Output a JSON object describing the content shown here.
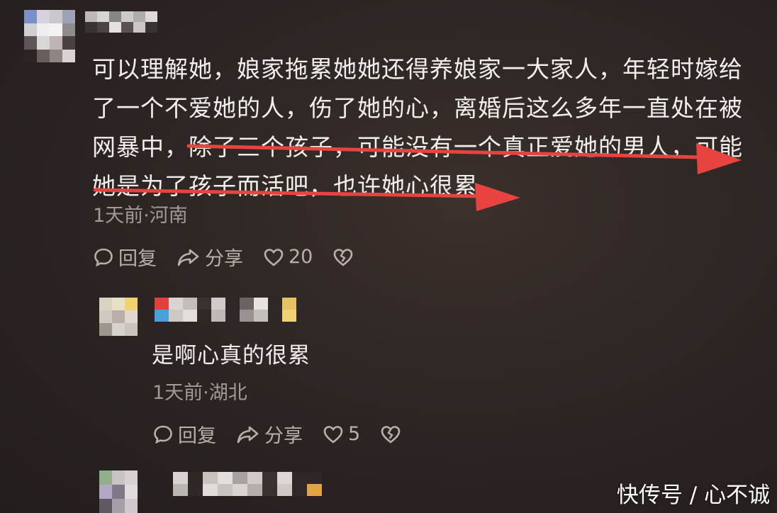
{
  "comment": {
    "lines": [
      "可以理解她，娘家拖累她她还得养娘家一大家人，年轻时嫁给",
      "了一个不爱她的人，伤了她的心，离婚后这么多年一直处在被",
      "网暴中，除了三个孩子，可能没有一个真正爱她的男人，可能",
      "她是为了孩子而活吧，也许她心很累。"
    ],
    "meta": "1天前·河南",
    "reply_label": "回复",
    "share_label": "分享",
    "like_count": "20"
  },
  "reply": {
    "text": "是啊心真的很累",
    "meta": "1天前·湖北",
    "reply_label": "回复",
    "share_label": "分享",
    "like_count": "5"
  },
  "watermark": "快传号 / 心不诚",
  "colors": {
    "annotation_arrow": "#e8443f",
    "background": "#2b2422"
  },
  "icons": [
    "comment-bubble-icon",
    "share-icon",
    "heart-icon",
    "broken-heart-icon"
  ]
}
